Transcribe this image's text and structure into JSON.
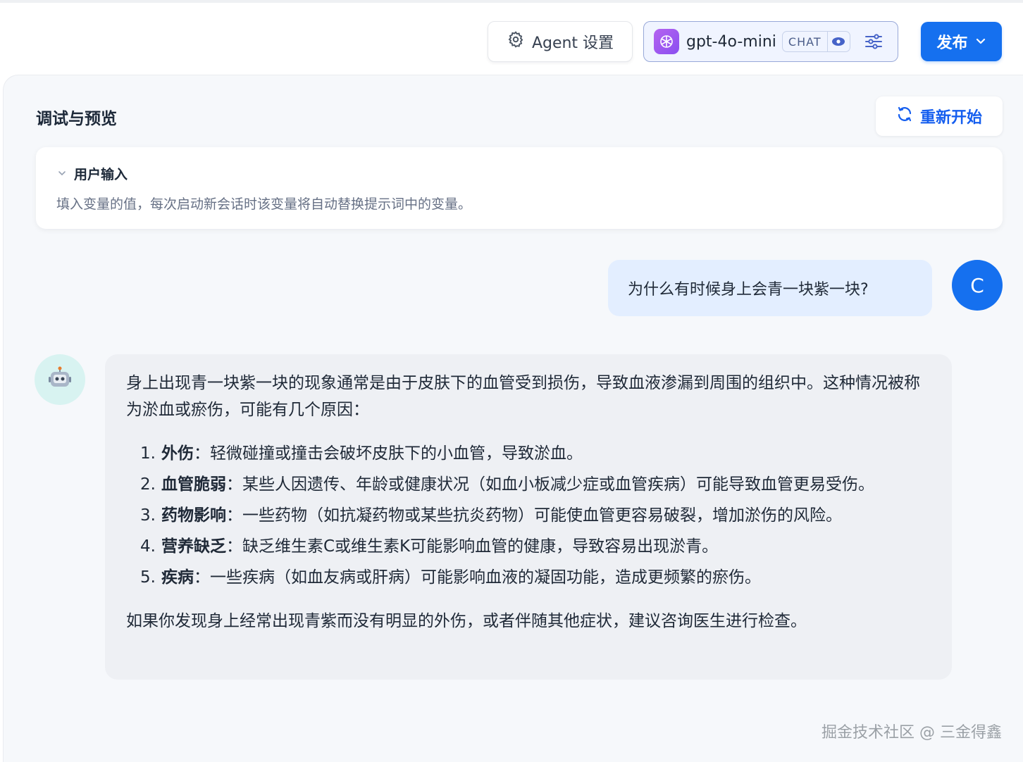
{
  "header": {
    "agent_settings_label": "Agent 设置",
    "model_name": "gpt-4o-mini",
    "model_mode_badge": "CHAT",
    "publish_label": "发布"
  },
  "panel": {
    "title": "调试与预览",
    "restart_label": "重新开始",
    "user_input": {
      "title": "用户输入",
      "description": "填入变量的值，每次启动新会话时该变量将自动替换提示词中的变量。"
    }
  },
  "chat": {
    "user_message": "为什么有时候身上会青一块紫一块?",
    "user_avatar_letter": "C",
    "bot_intro": "身上出现青一块紫一块的现象通常是由于皮肤下的血管受到损伤，导致血液渗漏到周围的组织中。这种情况被称为淤血或瘀伤，可能有几个原因：",
    "reasons": [
      {
        "num": "1.",
        "title": "外伤",
        "text": "：轻微碰撞或撞击会破坏皮肤下的小血管，导致淤血。"
      },
      {
        "num": "2.",
        "title": "血管脆弱",
        "text": "：某些人因遗传、年龄或健康状况（如血小板减少症或血管疾病）可能导致血管更易受伤。"
      },
      {
        "num": "3.",
        "title": "药物影响",
        "text": "：一些药物（如抗凝药物或某些抗炎药物）可能使血管更容易破裂，增加淤伤的风险。"
      },
      {
        "num": "4.",
        "title": "营养缺乏",
        "text": "：缺乏维生素C或维生素K可能影响血管的健康，导致容易出现淤青。"
      },
      {
        "num": "5.",
        "title": "疾病",
        "text": "：一些疾病（如血友病或肝病）可能影响血液的凝固功能，造成更频繁的瘀伤。"
      }
    ],
    "bot_outro": "如果你发现身上经常出现青紫而没有明显的外伤，或者伴随其他症状，建议咨询医生进行检查。"
  },
  "watermark": "掘金技术社区 @ 三金得鑫",
  "colors": {
    "primary": "#1570ef",
    "user_bubble": "#e3eeff",
    "bot_bubble": "#eef0f4"
  }
}
